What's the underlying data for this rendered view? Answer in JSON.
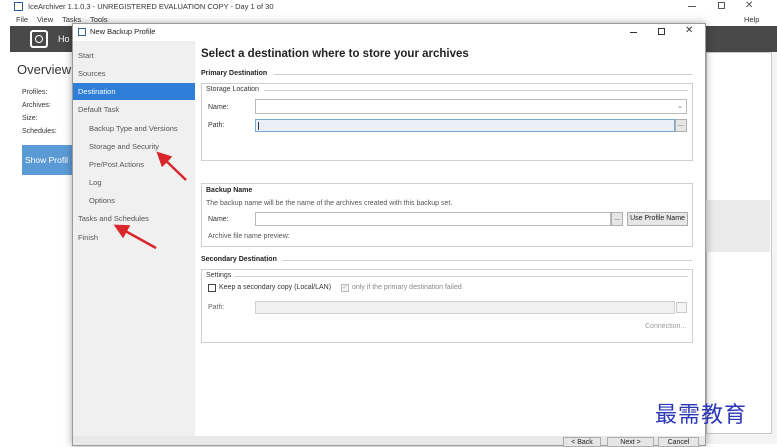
{
  "main": {
    "title": "IceArchiver 1.1.0.3 - UNREGISTERED EVALUATION COPY - Day 1 of 30",
    "menu": [
      "File",
      "View",
      "Tasks",
      "Tools"
    ],
    "help": "Help",
    "header_label": "Ho",
    "overview": "Overview",
    "stats": [
      "Profiles:",
      "Archives:",
      "Size:",
      "Schedules:"
    ],
    "show_profiles": "Show Profil"
  },
  "dialog": {
    "title": "New Backup Profile",
    "nav": [
      {
        "label": "Start",
        "indent": false,
        "active": false
      },
      {
        "label": "Sources",
        "indent": false,
        "active": false
      },
      {
        "label": "Destination",
        "indent": false,
        "active": true
      },
      {
        "label": "Default Task",
        "indent": false,
        "active": false
      },
      {
        "label": "Backup Type and Versions",
        "indent": true,
        "active": false
      },
      {
        "label": "Storage and Security",
        "indent": true,
        "active": false
      },
      {
        "label": "Pre/Post Actions",
        "indent": true,
        "active": false
      },
      {
        "label": "Log",
        "indent": true,
        "active": false
      },
      {
        "label": "Options",
        "indent": true,
        "active": false
      },
      {
        "label": "Tasks and Schedules",
        "indent": false,
        "active": false
      },
      {
        "label": "Finish",
        "indent": false,
        "active": false
      }
    ],
    "heading": "Select a destination where to store your archives",
    "primary": {
      "section": "Primary Destination",
      "group": "Storage Location",
      "name_label": "Name:",
      "path_label": "Path:",
      "browse": "..."
    },
    "backup_name": {
      "section": "Backup Name",
      "description": "The backup name will be the name of the archives created with this backup set.",
      "name_label": "Name:",
      "browse": "...",
      "use_profile_name": "Use Profile Name",
      "preview": "Archive file name preview:"
    },
    "secondary": {
      "section": "Secondary Destination",
      "group": "Settings",
      "keep_copy": "Keep a secondary copy (Local/LAN)",
      "only_if_failed": "only if the primary destination failed",
      "path_label": "Path:",
      "connection": "Connection..."
    },
    "buttons": {
      "back": "< Back",
      "next": "Next >",
      "cancel": "Cancel"
    }
  },
  "watermark": "最需教育",
  "colors": {
    "accent": "#2f7fd8",
    "arrow": "#d9262b",
    "watermark": "#2a38b8",
    "header": "#494949"
  }
}
